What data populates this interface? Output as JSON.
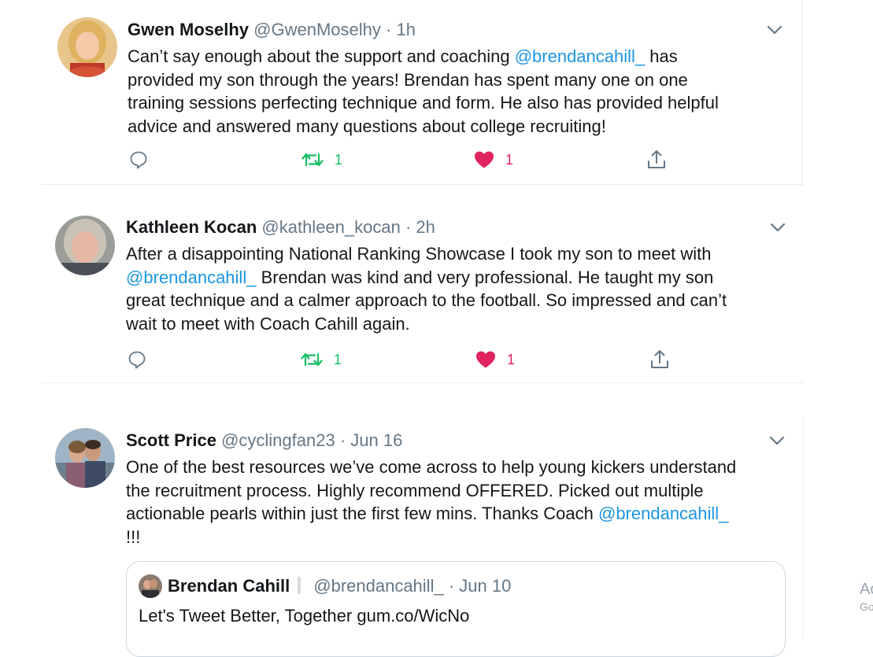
{
  "tweets": [
    {
      "name": "Gwen Moselhy",
      "handle": "@GwenMoselhy",
      "dot": "·",
      "time": "1h",
      "lines": [
        {
          "pre": "Can’t say enough about the support and coaching ",
          "mention": "@brendancahill_",
          "post": " has"
        },
        {
          "pre": "provided my son through the years!  Brendan has spent many one on one",
          "mention": "",
          "post": ""
        },
        {
          "pre": "training sessions perfecting technique and form.  He also has provided helpful",
          "mention": "",
          "post": ""
        },
        {
          "pre": "advice and answered many questions about college recruiting!",
          "mention": "",
          "post": ""
        }
      ],
      "retweets": "1",
      "likes": "1",
      "liked": true
    },
    {
      "name": "Kathleen Kocan",
      "handle": "@kathleen_kocan",
      "dot": "·",
      "time": "2h",
      "lines": [
        {
          "pre": "After a disappointing National Ranking Showcase I took my son to meet with",
          "mention": "",
          "post": ""
        },
        {
          "pre": "",
          "mention": "@brendancahill_",
          "post": "  Brendan was kind and very professional. He taught my son"
        },
        {
          "pre": "great technique and a calmer approach to the football. So impressed and can’t",
          "mention": "",
          "post": ""
        },
        {
          "pre": "wait to meet with Coach Cahill again.",
          "mention": "",
          "post": ""
        }
      ],
      "retweets": "1",
      "likes": "1",
      "liked": true
    },
    {
      "name": "Scott Price",
      "handle": "@cyclingfan23",
      "dot": "·",
      "time": "Jun 16",
      "lines": [
        {
          "pre": "One of the best resources we’ve come across to help young kickers understand",
          "mention": "",
          "post": ""
        },
        {
          "pre": "the recruitment process. Highly recommend OFFERED. Picked out multiple",
          "mention": "",
          "post": ""
        },
        {
          "pre": "actionable pearls within just the first few mins. Thanks Coach ",
          "mention": "@brendancahill_",
          "post": ""
        },
        {
          "pre": "!!!",
          "mention": "",
          "post": ""
        }
      ],
      "quote": {
        "name": "Brendan Cahill",
        "handle": "@brendancahill_",
        "dot": "·",
        "time": "Jun 10",
        "text": "Let's Tweet Better, Together gum.co/WicNo"
      }
    }
  ],
  "ad": {
    "line1": "Ac",
    "line2": "Go"
  },
  "colors": {
    "mention": "#1b95e0",
    "retweet": "#17bf63",
    "like": "#e0245e",
    "muted": "#657786"
  },
  "icons": {
    "reply": "reply-icon",
    "retweet": "retweet-icon",
    "like": "heart-icon",
    "share": "share-icon",
    "menu": "chevron-down-icon"
  }
}
